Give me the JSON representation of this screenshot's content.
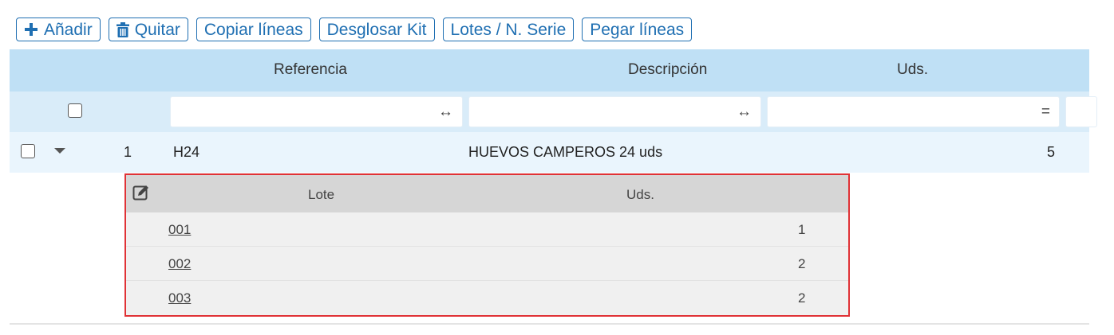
{
  "toolbar": {
    "add_label": "Añadir",
    "remove_label": "Quitar",
    "copy_lines_label": "Copiar líneas",
    "explode_kit_label": "Desglosar Kit",
    "lots_serial_label": "Lotes / N. Serie",
    "paste_lines_label": "Pegar líneas"
  },
  "grid": {
    "columns": {
      "reference": "Referencia",
      "description": "Descripción",
      "units": "Uds."
    },
    "filters": {
      "reference_symbol": "↔",
      "description_symbol": "↔",
      "units_symbol": "="
    },
    "rows": [
      {
        "number": "1",
        "reference": "H24",
        "description": "HUEVOS CAMPEROS 24 uds",
        "units": "5"
      }
    ]
  },
  "lots": {
    "header": {
      "lot": "Lote",
      "units": "Uds."
    },
    "rows": [
      {
        "lot": "001",
        "units": "1"
      },
      {
        "lot": "002",
        "units": "2"
      },
      {
        "lot": "003",
        "units": "2"
      }
    ]
  },
  "colors": {
    "accent": "#1f6fb2",
    "header_bg": "#bfe0f5",
    "highlight_border": "#e03236"
  }
}
